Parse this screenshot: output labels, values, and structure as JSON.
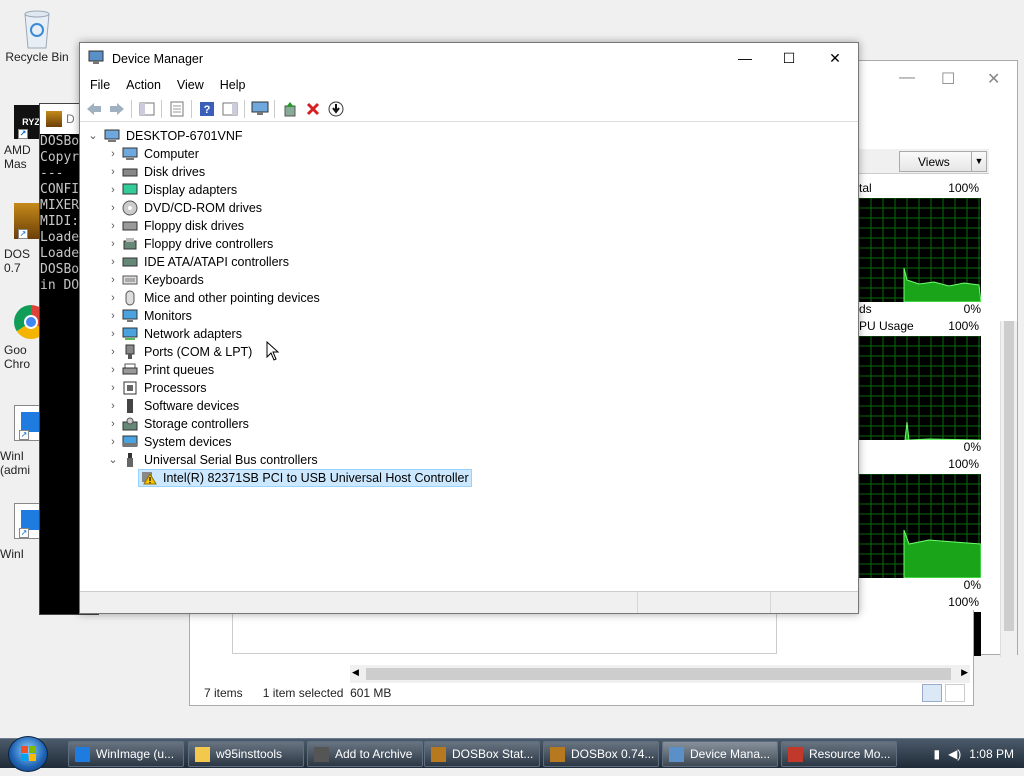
{
  "desktop": {
    "icons": [
      {
        "label": "Recycle Bin"
      },
      {
        "label": "AMD\nMas"
      },
      {
        "label": "DOS\n0.7"
      },
      {
        "label": "Goo\nChro"
      },
      {
        "label": "WinI\n(admi"
      },
      {
        "label": "WinI"
      }
    ]
  },
  "dosbox": {
    "title_fragment": "D",
    "lines": [
      "DOSBo",
      "Copyr",
      "---",
      "CONFI",
      "MIXER",
      "MIDI:",
      "Loade",
      "Loade",
      "DOSBo",
      "in DO"
    ]
  },
  "resource_monitor": {
    "views_label": "Views",
    "panels": [
      {
        "title": "tal",
        "max": "100%",
        "subtitle": "ds",
        "min": "0%"
      },
      {
        "title": "PU Usage",
        "max": "100%",
        "min": "0%"
      },
      {
        "title": "",
        "max": "100%",
        "min": "0%"
      },
      {
        "title": "",
        "max": "100%"
      }
    ]
  },
  "explorer": {
    "status_items": "7 items",
    "status_selected": "1 item selected  601 MB"
  },
  "device_manager": {
    "title": "Device Manager",
    "menu": [
      "File",
      "Action",
      "View",
      "Help"
    ],
    "root": "DESKTOP-6701VNF",
    "categories": [
      {
        "label": "Computer",
        "icon": "computer-icon"
      },
      {
        "label": "Disk drives",
        "icon": "disk-drive-icon"
      },
      {
        "label": "Display adapters",
        "icon": "display-adapter-icon"
      },
      {
        "label": "DVD/CD-ROM drives",
        "icon": "dvd-drive-icon"
      },
      {
        "label": "Floppy disk drives",
        "icon": "floppy-drive-icon"
      },
      {
        "label": "Floppy drive controllers",
        "icon": "floppy-controller-icon"
      },
      {
        "label": "IDE ATA/ATAPI controllers",
        "icon": "ide-controller-icon"
      },
      {
        "label": "Keyboards",
        "icon": "keyboard-icon"
      },
      {
        "label": "Mice and other pointing devices",
        "icon": "mouse-icon"
      },
      {
        "label": "Monitors",
        "icon": "monitor-icon"
      },
      {
        "label": "Network adapters",
        "icon": "network-adapter-icon"
      },
      {
        "label": "Ports (COM & LPT)",
        "icon": "port-icon"
      },
      {
        "label": "Print queues",
        "icon": "printer-icon"
      },
      {
        "label": "Processors",
        "icon": "processor-icon"
      },
      {
        "label": "Software devices",
        "icon": "software-device-icon"
      },
      {
        "label": "Storage controllers",
        "icon": "storage-controller-icon"
      },
      {
        "label": "System devices",
        "icon": "system-device-icon"
      },
      {
        "label": "Universal Serial Bus controllers",
        "icon": "usb-icon",
        "expanded": true
      }
    ],
    "usb_child": {
      "label": "Intel(R) 82371SB PCI to USB Universal Host Controller",
      "icon": "warning-icon",
      "selected": true
    },
    "accent": "#cce8ff"
  },
  "taskbar": {
    "tasks": [
      {
        "label": "WinImage (u...",
        "icon": "winimage-icon"
      },
      {
        "label": "w95insttools",
        "icon": "folder-icon"
      },
      {
        "label": "Add to Archive",
        "icon": "archive-icon"
      },
      {
        "label": "DOSBox Stat...",
        "icon": "dosbox-icon"
      },
      {
        "label": "DOSBox 0.74...",
        "icon": "dosbox-icon"
      },
      {
        "label": "Device Mana...",
        "icon": "device-manager-icon",
        "active": true
      },
      {
        "label": "Resource Mo...",
        "icon": "resource-monitor-icon"
      }
    ],
    "clock": "1:08 PM"
  }
}
